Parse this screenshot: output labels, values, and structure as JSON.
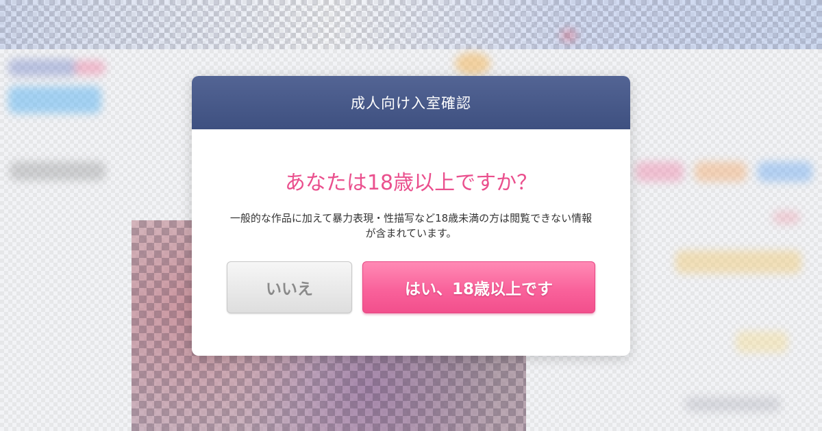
{
  "modal": {
    "title": "成人向け入室確認",
    "question": "あなたは18歳以上ですか？",
    "description": "一般的な作品に加えて暴力表現・性描写など18歳未満の方は閲覧できない情報が含まれています。",
    "no_button_label": "いいえ",
    "yes_button_label": "はい、18歳以上です"
  },
  "colors": {
    "header_background": "#3e5080",
    "question_text": "#ea4f8d",
    "yes_button": "#f9629b",
    "no_button": "#e6e6e6"
  }
}
